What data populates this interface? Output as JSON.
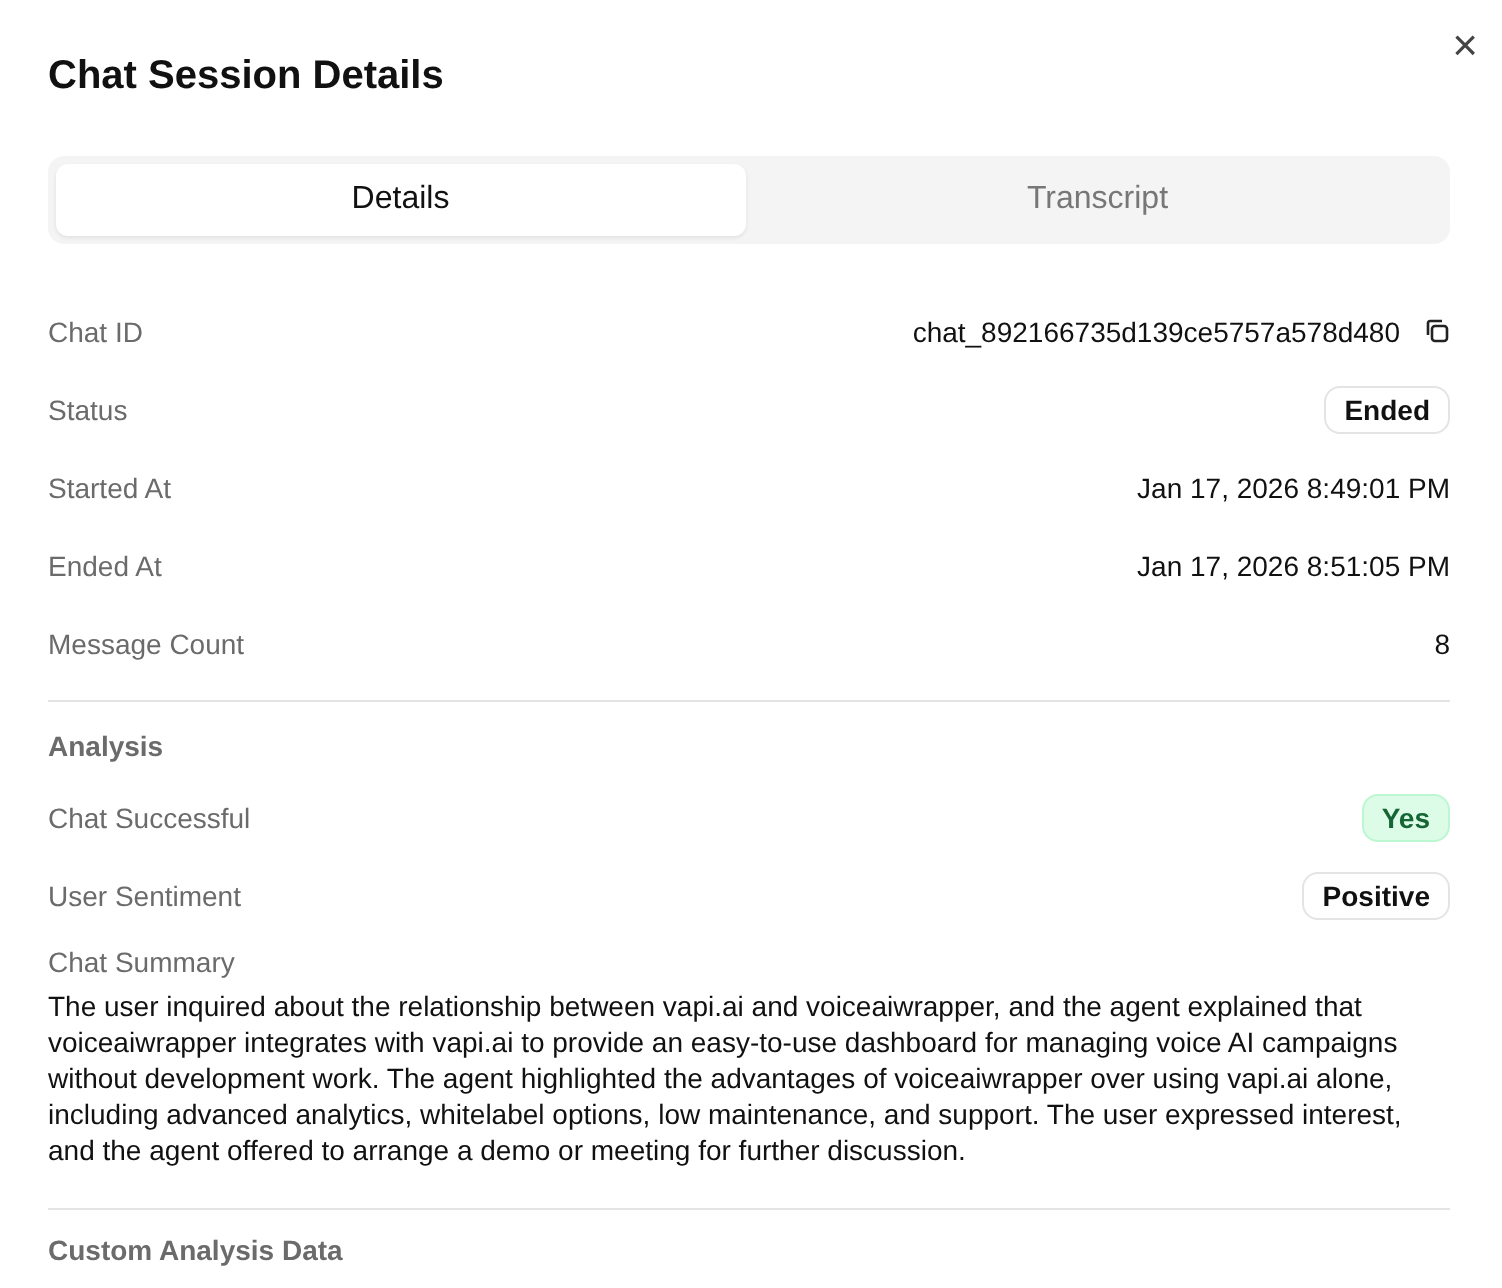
{
  "dialog": {
    "title": "Chat Session Details",
    "close": "×"
  },
  "tabs": [
    {
      "label": "Details",
      "selected": true
    },
    {
      "label": "Transcript",
      "selected": false
    }
  ],
  "details": [
    {
      "label": "Chat ID",
      "value": "chat_892166735d139ce5757a578d480",
      "kind": "copyable"
    },
    {
      "label": "Status",
      "value": "Ended",
      "kind": "badge"
    },
    {
      "label": "Started At",
      "value": "Jan 17, 2026 8:49:01 PM",
      "kind": "text"
    },
    {
      "label": "Ended At",
      "value": "Jan 17, 2026 8:51:05 PM",
      "kind": "text"
    },
    {
      "label": "Message Count",
      "value": "8",
      "kind": "text"
    }
  ],
  "analysis": {
    "heading": "Analysis",
    "rows": [
      {
        "label": "Chat Successful",
        "value": "Yes",
        "kind": "success"
      },
      {
        "label": "User Sentiment",
        "value": "Positive",
        "kind": "badge"
      }
    ],
    "summary_label": "Chat Summary",
    "summary": "The user inquired about the relationship between vapi.ai and voiceaiwrapper, and the agent explained that voiceaiwrapper integrates with vapi.ai to provide an easy-to-use dashboard for managing voice AI campaigns without development work. The agent highlighted the advantages of voiceaiwrapper over using vapi.ai alone, including advanced analytics, whitelabel options, low maintenance, and support. The user expressed interest, and the agent offered to arrange a demo or meeting for further discussion."
  },
  "custom_analysis": {
    "heading": "Custom Analysis Data"
  }
}
